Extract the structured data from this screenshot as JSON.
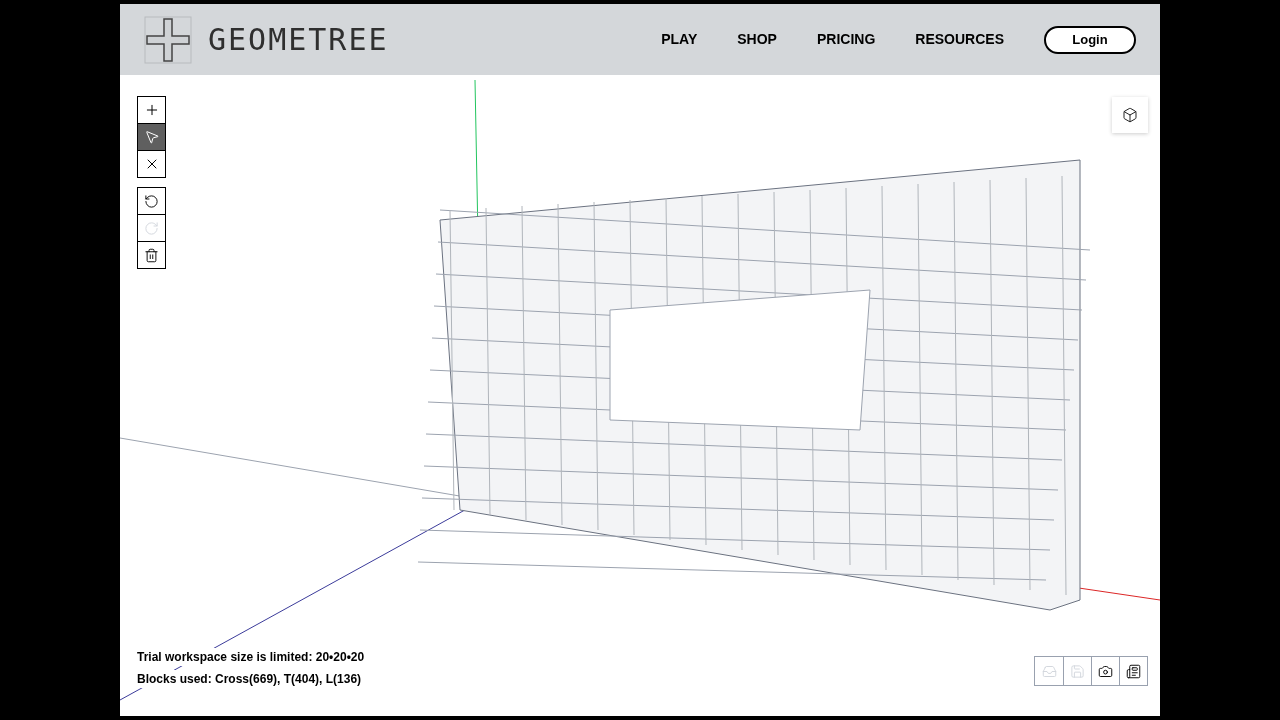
{
  "header": {
    "logo_text": "GEOMETREE",
    "nav": [
      {
        "label": "PLAY"
      },
      {
        "label": "SHOP"
      },
      {
        "label": "PRICING"
      },
      {
        "label": "RESOURCES"
      }
    ],
    "login": "Login"
  },
  "tools": [
    {
      "kind": "add",
      "selected": false,
      "disabled": false
    },
    {
      "kind": "select",
      "selected": true,
      "disabled": false
    },
    {
      "kind": "remove",
      "selected": false,
      "disabled": false
    }
  ],
  "history_tools": [
    {
      "kind": "undo",
      "disabled": false
    },
    {
      "kind": "redo",
      "disabled": true
    },
    {
      "kind": "delete",
      "disabled": false
    }
  ],
  "status": [
    "Trial workspace size is limited: 20•20•20",
    "Blocks used: Cross(669), T(404), L(136)"
  ],
  "bottom_tools": [
    {
      "kind": "tray",
      "disabled": true
    },
    {
      "kind": "save",
      "disabled": true
    },
    {
      "kind": "camera",
      "disabled": false
    },
    {
      "kind": "document",
      "disabled": false
    }
  ]
}
